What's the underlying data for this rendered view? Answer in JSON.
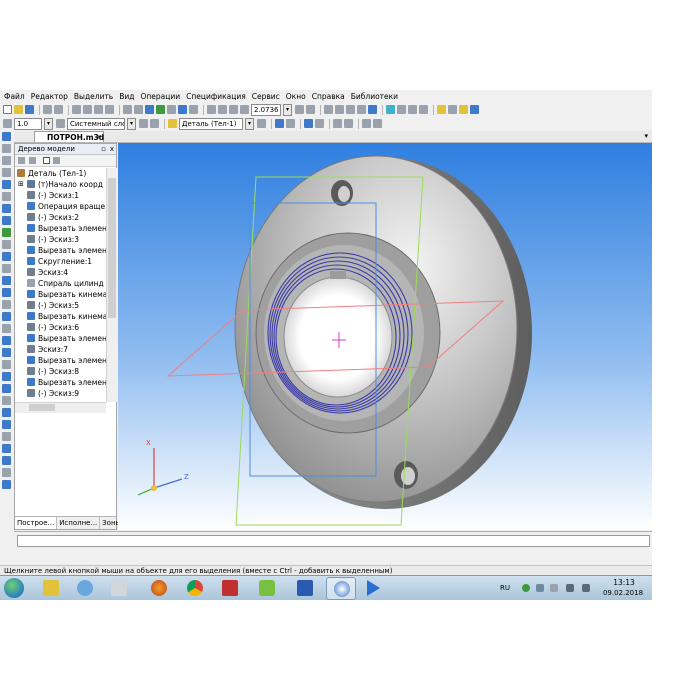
{
  "menu": [
    "Файл",
    "Редактор",
    "Выделить",
    "Вид",
    "Операции",
    "Спецификация",
    "Сервис",
    "Окно",
    "Справка",
    "Библиотеки"
  ],
  "toolbar1": {
    "zoom_value": "2.0736"
  },
  "toolbar2": {
    "step_value": "1.0",
    "layer_value": "Системный слой",
    "detail_value": "Деталь (Тел-1)"
  },
  "document": {
    "tab_title": "ПОТРОН.m3d",
    "tab_close": "x",
    "tab_menu": "▾"
  },
  "tree": {
    "title": "Дерево модели",
    "pin": "▫",
    "close": "x",
    "items": [
      {
        "label": "Деталь (Тел-1)",
        "icon": "part-icon"
      },
      {
        "label": "(т)Начало коорд",
        "icon": "origin-icon"
      },
      {
        "label": "(-) Эскиз:1",
        "icon": "sketch-icon"
      },
      {
        "label": "Операция враще",
        "icon": "rotate-op-icon"
      },
      {
        "label": "(-) Эскиз:2",
        "icon": "sketch-icon"
      },
      {
        "label": "Вырезать элемен",
        "icon": "cut-extrude-icon"
      },
      {
        "label": "(-) Эскиз:3",
        "icon": "sketch-icon"
      },
      {
        "label": "Вырезать элемен",
        "icon": "cut-extrude-icon"
      },
      {
        "label": "Скругление:1",
        "icon": "fillet-icon"
      },
      {
        "label": "Эскиз:4",
        "icon": "sketch-icon"
      },
      {
        "label": "Спираль цилинд",
        "icon": "helix-icon"
      },
      {
        "label": "Вырезать кинема",
        "icon": "cut-sweep-icon"
      },
      {
        "label": "(-) Эскиз:5",
        "icon": "sketch-icon"
      },
      {
        "label": "Вырезать кинема",
        "icon": "cut-sweep-icon"
      },
      {
        "label": "(-) Эскиз:6",
        "icon": "sketch-icon"
      },
      {
        "label": "Вырезать элемен",
        "icon": "cut-extrude-icon"
      },
      {
        "label": "Эскиз:7",
        "icon": "sketch-icon"
      },
      {
        "label": "Вырезать элемен",
        "icon": "cut-extrude-icon"
      },
      {
        "label": "(-) Эскиз:8",
        "icon": "sketch-icon"
      },
      {
        "label": "Вырезать элемен",
        "icon": "cut-extrude-icon"
      },
      {
        "label": "(-) Эскиз:9",
        "icon": "sketch-icon"
      }
    ],
    "bottom_tabs": [
      "Построе...",
      "Исполне...",
      "Зоны"
    ]
  },
  "axes": {
    "x": "X",
    "z": "Z"
  },
  "status_text": "Щелкните левой кнопкой мыши на объекте для его выделения (вместе с Ctrl - добавить к выделенным)",
  "taskbar": {
    "language": "RU",
    "time": "13:13",
    "date": "09.02.2018",
    "apps": [
      "explorer-icon",
      "paint-icon",
      "calculator-icon",
      "firefox-icon",
      "chrome-icon",
      "winrar-icon",
      "gimp-icon",
      "word-icon",
      "kompas-icon",
      "media-player-icon"
    ]
  },
  "colors": {
    "viewport_top": "#2f7fe0",
    "viewport_bottom": "#ffffff",
    "part_gray": "#c8c8c8",
    "thread_blue": "#3a3aa8",
    "plane_blue": "#4a8fe0",
    "plane_green": "#9bdc5a",
    "plane_red": "#f08080"
  }
}
